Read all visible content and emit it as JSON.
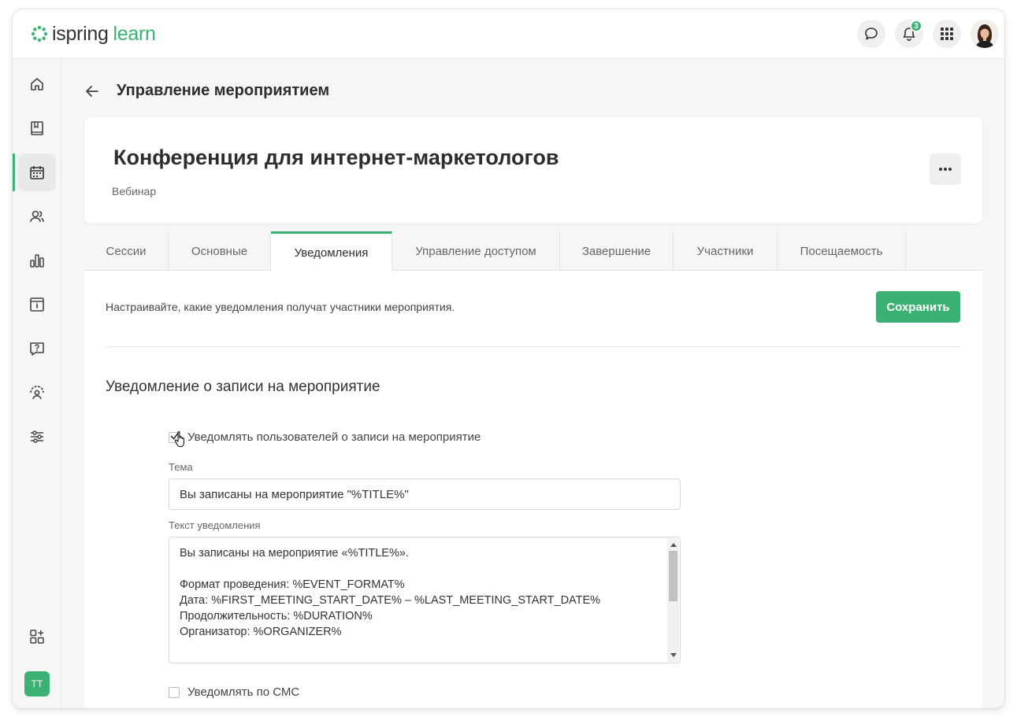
{
  "app": {
    "logo_part1": "ispring",
    "logo_part2": "learn",
    "notifications_count": "3",
    "brand_color": "#3bb273"
  },
  "sidebar": {
    "items": [
      {
        "icon": "home-icon"
      },
      {
        "icon": "book-icon"
      },
      {
        "icon": "calendar-icon",
        "active": true
      },
      {
        "icon": "users-icon"
      },
      {
        "icon": "bar-chart-icon"
      },
      {
        "icon": "info-card-icon"
      },
      {
        "icon": "question-icon"
      },
      {
        "icon": "gauge-user-icon"
      },
      {
        "icon": "sliders-icon"
      },
      {
        "icon": "apps-add-icon"
      }
    ],
    "user_initials": "TT"
  },
  "header": {
    "title": "Управление мероприятием"
  },
  "event": {
    "title": "Конференция для интернет-маркетологов",
    "type": "Вебинар"
  },
  "tabs": [
    {
      "label": "Сессии"
    },
    {
      "label": "Основные"
    },
    {
      "label": "Уведомления",
      "active": true
    },
    {
      "label": "Управление доступом"
    },
    {
      "label": "Завершение"
    },
    {
      "label": "Участники"
    },
    {
      "label": "Посещаемость"
    }
  ],
  "notifications": {
    "intro": "Настраивайте, какие уведомления получат участники мероприятия.",
    "save_label": "Сохранить",
    "section_title": "Уведомление о записи на мероприятие",
    "notify_checkbox_label": "Уведомлять пользователей о записи на мероприятие",
    "notify_checked": true,
    "subject_label": "Тема",
    "subject_value": "Вы записаны на мероприятие \"%TITLE%\"",
    "body_label": "Текст уведомления",
    "body_lines": [
      "Вы записаны на мероприятие «%TITLE%».",
      "",
      "Формат проведения: %EVENT_FORMAT%",
      "Дата: %FIRST_MEETING_START_DATE% – %LAST_MEETING_START_DATE%",
      "Продолжительность: %DURATION%",
      "Организатор: %ORGANIZER%"
    ],
    "sms_label": "Уведомлять по СМС",
    "sms_checked": false
  }
}
